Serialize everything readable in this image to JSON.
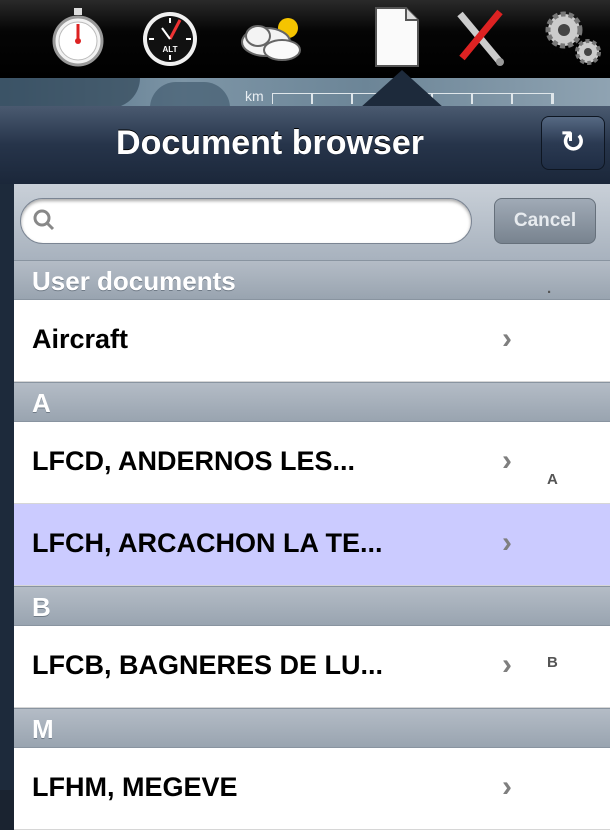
{
  "toolbar": {
    "icons": [
      "stopwatch-icon",
      "altimeter-icon",
      "weather-icon",
      "document-icon",
      "tools-icon",
      "settings-gears-icon"
    ],
    "altimeter_label": "ALT"
  },
  "map": {
    "scale_unit": "km"
  },
  "nav": {
    "title": "Document browser",
    "refresh_icon": "↻"
  },
  "search": {
    "placeholder": "",
    "value": "",
    "cancel_label": "Cancel"
  },
  "list": {
    "sections": [
      {
        "header": "User documents",
        "rows": [
          {
            "label": "Aircraft",
            "selected": false
          }
        ]
      },
      {
        "header": "A",
        "rows": [
          {
            "label": "LFCD, ANDERNOS LES...",
            "selected": false
          },
          {
            "label": "LFCH, ARCACHON LA TE...",
            "selected": true
          }
        ]
      },
      {
        "header": "B",
        "rows": [
          {
            "label": "LFCB, BAGNERES DE LU...",
            "selected": false
          }
        ]
      },
      {
        "header": "M",
        "rows": [
          {
            "label": "LFHM, MEGEVE",
            "selected": false
          }
        ]
      }
    ],
    "index": [
      "·",
      "A",
      "B"
    ]
  },
  "colors": {
    "selected_row": "#cbcbff",
    "nav_bar": "#26344a",
    "section_header": "#a6afba"
  }
}
